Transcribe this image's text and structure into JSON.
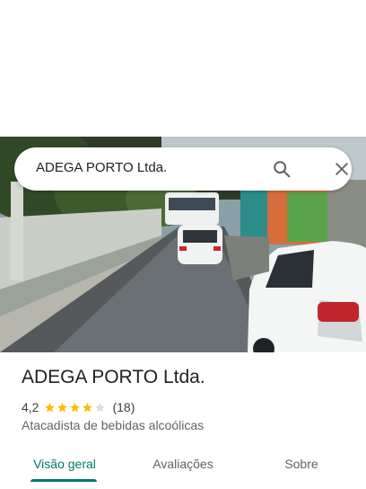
{
  "search": {
    "query": "ADEGA PORTO Ltda.",
    "search_icon": "search-icon",
    "close_icon": "close-icon"
  },
  "place": {
    "name": "ADEGA PORTO Ltda.",
    "rating": "4,2",
    "rating_value": 4.2,
    "stars_filled": 4,
    "review_count": "(18)",
    "category": "Atacadista de bebidas alcoólicas"
  },
  "tabs": [
    {
      "label": "Visão geral",
      "active": true
    },
    {
      "label": "Avaliações",
      "active": false
    },
    {
      "label": "Sobre",
      "active": false
    }
  ],
  "colors": {
    "accent": "#00796b",
    "star": "#fbbc04",
    "star_empty": "#dadce0"
  }
}
